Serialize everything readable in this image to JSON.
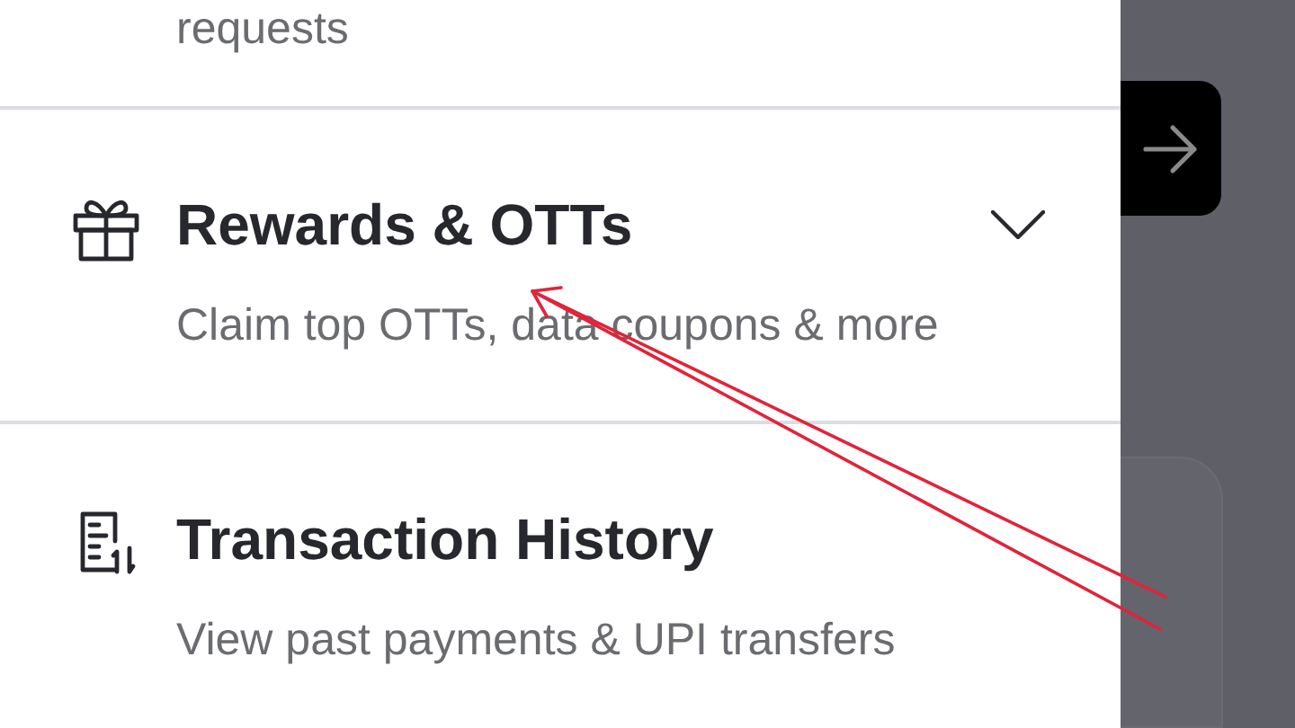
{
  "top_item": {
    "subtitle": "requests"
  },
  "menu_items": [
    {
      "kind": "expandable",
      "title": "Rewards & OTTs",
      "subtitle": "Claim top OTTs, data coupons & more"
    },
    {
      "kind": "link",
      "title": "Transaction History",
      "subtitle": "View past payments & UPI transfers"
    }
  ]
}
